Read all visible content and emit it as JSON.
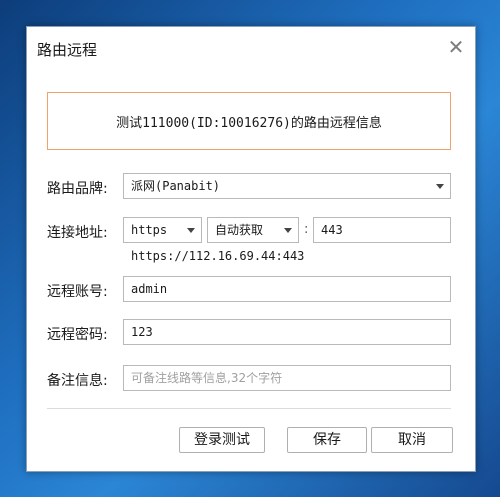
{
  "window": {
    "title": "路由远程"
  },
  "banner": {
    "text": "测试111000(ID:10016276)的路由远程信息"
  },
  "form": {
    "brand": {
      "label": "路由品牌:",
      "value": "派网(Panabit)"
    },
    "address": {
      "label": "连接地址:",
      "protocol": "https",
      "mode": "自动获取",
      "separator": ":",
      "port": "443",
      "url": "https://112.16.69.44:443"
    },
    "account": {
      "label": "远程账号:",
      "value": "admin"
    },
    "password": {
      "label": "远程密码:",
      "value": "123"
    },
    "remark": {
      "label": "备注信息:",
      "value": "",
      "placeholder": "可备注线路等信息,32个字符"
    }
  },
  "buttons": {
    "test": "登录测试",
    "save": "保存",
    "cancel": "取消"
  },
  "colors": {
    "banner_border": "#f0a46a",
    "accent_background": "#1f6fc0"
  }
}
